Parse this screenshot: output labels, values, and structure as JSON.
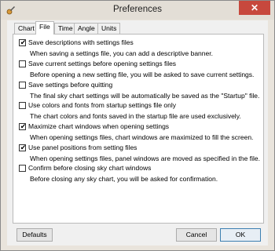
{
  "window": {
    "title": "Preferences",
    "close_glyph": "✕"
  },
  "tabs": [
    "Chart",
    "File",
    "Time",
    "Angle",
    "Units"
  ],
  "active_tab": "File",
  "options": [
    {
      "label": "Save descriptions with settings files",
      "checked": true,
      "description": "When saving a settings file, you can add a descriptive banner."
    },
    {
      "label": "Save current settings before opening settings files",
      "checked": false,
      "description": "Before opening a new setting file, you will be asked to save current settings."
    },
    {
      "label": "Save settings before quitting",
      "checked": false,
      "description": "The final sky chart settings will be automatically be saved as the \"Startup\" file."
    },
    {
      "label": "Use colors and fonts from startup settings file only",
      "checked": false,
      "description": "The chart colors and fonts saved in the startup file are used exclusively."
    },
    {
      "label": "Maximize chart windows when opening settings",
      "checked": true,
      "description": "When opening settings files, chart windows are maximized to fill the screen."
    },
    {
      "label": "Use panel positions from setting files",
      "checked": true,
      "description": "When opening settings files, panel windows are moved as specified in the file."
    },
    {
      "label": "Confirm before closing sky chart windows",
      "checked": false,
      "description": "Before closing any sky chart, you will be asked for confirmation."
    }
  ],
  "buttons": {
    "defaults": "Defaults",
    "cancel": "Cancel",
    "ok": "OK"
  },
  "colors": {
    "close_button": "#c7483d",
    "default_button_border": "#3c7fb1"
  }
}
